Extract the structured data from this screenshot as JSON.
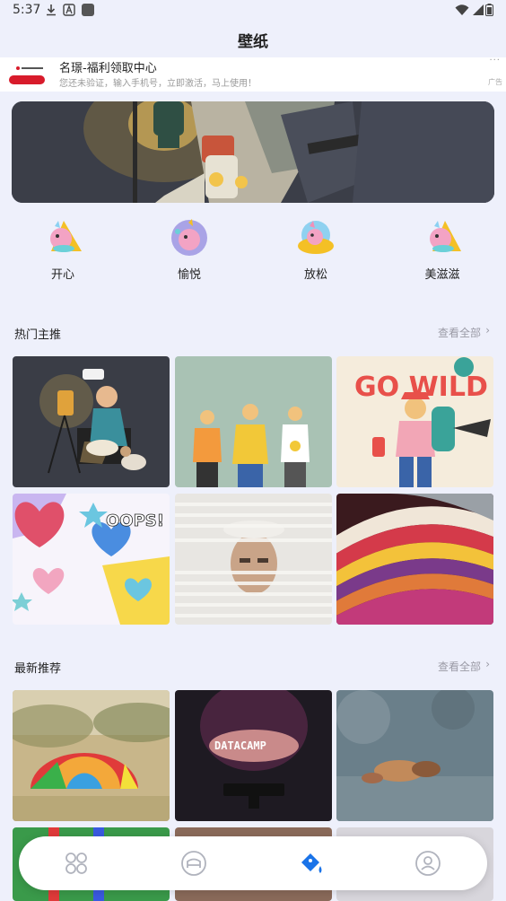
{
  "status_bar": {
    "time": "5:37"
  },
  "app": {
    "title": "壁纸"
  },
  "ad": {
    "title": "名璟-福利领取中心",
    "subtitle": "您还未验证，输入手机号，立即激活，马上使用！",
    "tag": "广告",
    "more": "···"
  },
  "moods": [
    {
      "label": "开心",
      "icon": "unicorn-happy-icon"
    },
    {
      "label": "愉悦",
      "icon": "unicorn-joy-icon"
    },
    {
      "label": "放松",
      "icon": "unicorn-relax-icon"
    },
    {
      "label": "美滋滋",
      "icon": "unicorn-delight-icon"
    }
  ],
  "hot": {
    "title": "热门主推",
    "see_all": "查看全部",
    "chevron": "›"
  },
  "latest": {
    "title": "最新推荐",
    "see_all": "查看全部",
    "chevron": "›"
  },
  "hot_tiles": [
    {
      "name": "tile-camping-girl-dog"
    },
    {
      "name": "tile-three-friends"
    },
    {
      "name": "tile-go-wild-hiker",
      "text": "GO WILD"
    },
    {
      "name": "tile-hearts-oops",
      "text": "OOPS!"
    },
    {
      "name": "tile-man-blinds"
    },
    {
      "name": "tile-colorful-stripes"
    }
  ],
  "latest_tiles": [
    {
      "name": "tile-rainbow-umbrella"
    },
    {
      "name": "tile-datacamp-hands",
      "text": "DATACAMP"
    },
    {
      "name": "tile-bokeh-pebbles"
    }
  ],
  "nav": [
    {
      "name": "nav-home",
      "icon": "grid-icon"
    },
    {
      "name": "nav-category",
      "icon": "sofa-icon"
    },
    {
      "name": "nav-wallpaper",
      "icon": "paint-bucket-icon",
      "active": true
    },
    {
      "name": "nav-profile",
      "icon": "user-icon"
    }
  ],
  "colors": {
    "accent": "#1a73e8",
    "background": "#eef0fb",
    "ad_red": "#d81b2b"
  }
}
